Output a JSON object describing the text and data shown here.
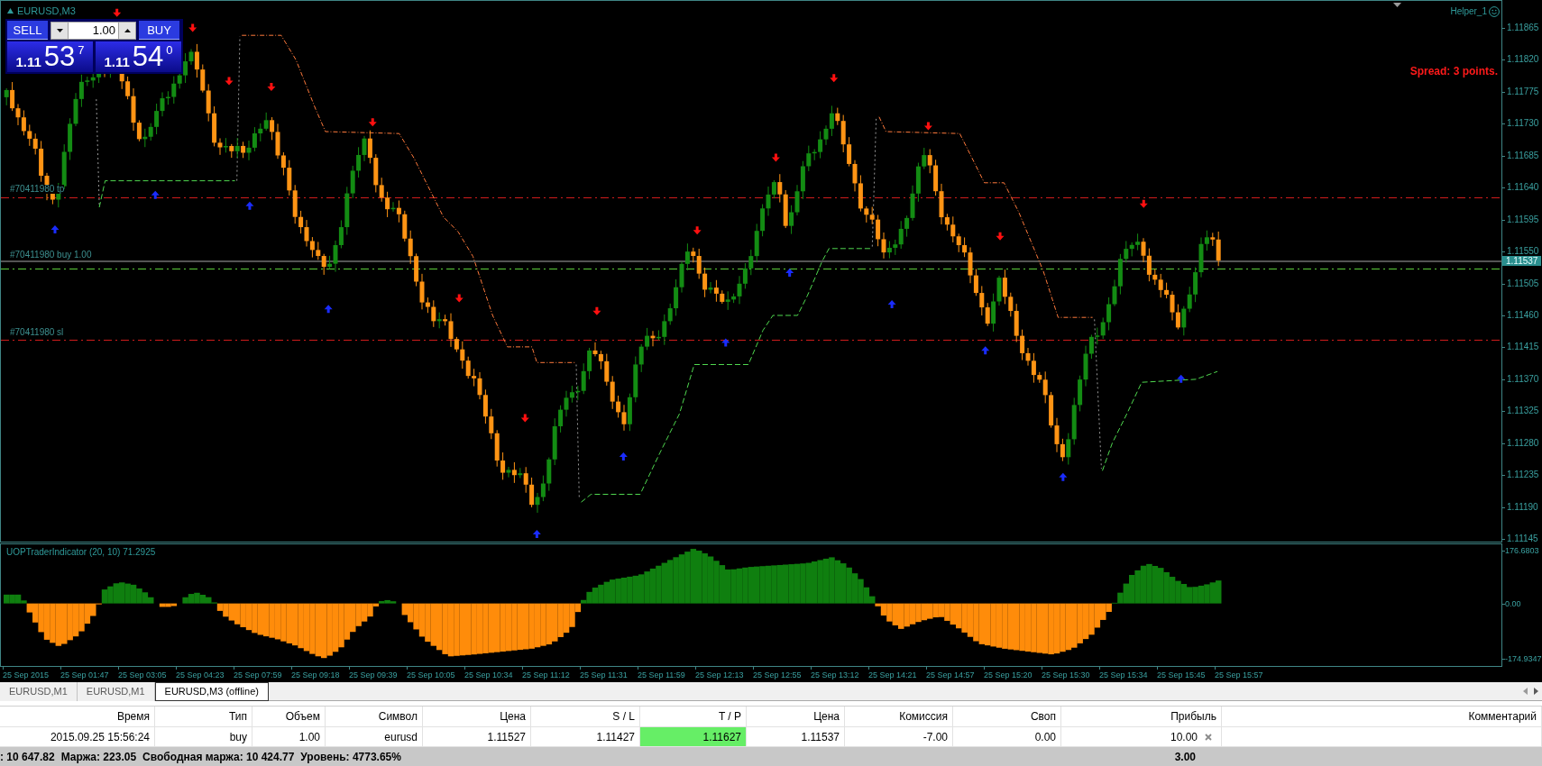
{
  "chart": {
    "title": "EURUSD,M3",
    "expert": "Helper_1",
    "spread": "Spread: 3 points.",
    "trade_panel": {
      "sell": "SELL",
      "buy": "BUY",
      "lot": "1.00",
      "bid": {
        "base": "1.11",
        "pips": "53",
        "point": "7"
      },
      "ask": {
        "base": "1.11",
        "pips": "54",
        "point": "0"
      }
    },
    "order_lines": [
      {
        "label": "#70411980 tp",
        "color": "#d01c1c"
      },
      {
        "label": "#70411980 buy 1.00",
        "color": "#5ccf3c"
      },
      {
        "label": "#70411980 sl",
        "color": "#d01c1c"
      }
    ],
    "price_axis": [
      "1.11865",
      "1.11820",
      "1.11775",
      "1.11730",
      "1.11685",
      "1.11640",
      "1.11595",
      "1.11550",
      "1.11505",
      "1.11460",
      "1.11415",
      "1.11370",
      "1.11325",
      "1.11280",
      "1.11235",
      "1.11190",
      "1.11145"
    ],
    "current_price": "1.11537"
  },
  "indicator": {
    "title": "UOPTraderIndicator (20, 10) 71.2925",
    "axis": [
      "176.6803",
      "0.00",
      "-174.9347"
    ]
  },
  "time_axis": [
    "25 Sep 2015",
    "25 Sep 01:47",
    "25 Sep 03:05",
    "25 Sep 04:23",
    "25 Sep 07:59",
    "25 Sep 09:18",
    "25 Sep 09:39",
    "25 Sep 10:05",
    "25 Sep 10:34",
    "25 Sep 11:12",
    "25 Sep 11:31",
    "25 Sep 11:59",
    "25 Sep 12:13",
    "25 Sep 12:55",
    "25 Sep 13:12",
    "25 Sep 14:21",
    "25 Sep 14:57",
    "25 Sep 15:20",
    "25 Sep 15:30",
    "25 Sep 15:34",
    "25 Sep 15:45",
    "25 Sep 15:57"
  ],
  "chart_tabs": [
    {
      "label": "EURUSD,M1",
      "selected": false
    },
    {
      "label": "EURUSD,M1",
      "selected": false
    },
    {
      "label": "EURUSD,M3 (offline)",
      "selected": true
    }
  ],
  "trade_table": {
    "columns": [
      "Время",
      "Тип",
      "Объем",
      "Символ",
      "Цена",
      "S / L",
      "T / P",
      "Цена",
      "Комиссия",
      "Своп",
      "Прибыль",
      "Комментарий"
    ],
    "rows": [
      {
        "cells": [
          {
            "text": "2015.09.25 15:56:24",
            "highlighted": false
          },
          {
            "text": "buy",
            "highlighted": false
          },
          {
            "text": "1.00",
            "highlighted": false
          },
          {
            "text": "eurusd",
            "highlighted": false
          },
          {
            "text": "1.11527",
            "highlighted": false
          },
          {
            "text": "1.11427",
            "highlighted": false
          },
          {
            "text": "1.11627",
            "highlighted": true
          },
          {
            "text": "1.11537",
            "highlighted": false
          },
          {
            "text": "-7.00",
            "highlighted": false
          },
          {
            "text": "0.00",
            "highlighted": false
          },
          {
            "text": "10.00",
            "highlighted": false
          }
        ]
      }
    ]
  },
  "status_bar": {
    "items": [
      ": 10 647.82",
      "Маржа: 223.05",
      "Свободная маржа: 10 424.77",
      "Уровень: 4773.65%"
    ],
    "profit": "3.00"
  }
}
